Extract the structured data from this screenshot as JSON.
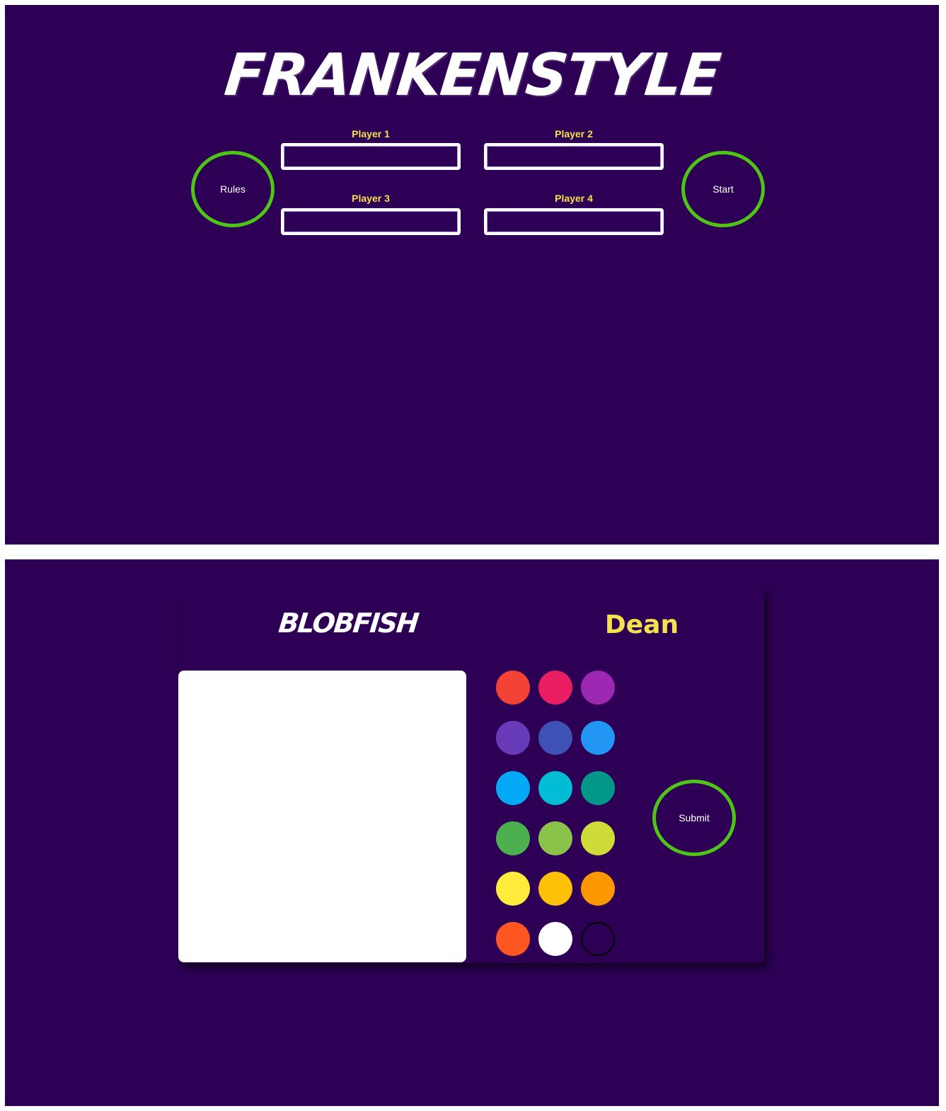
{
  "lobby": {
    "title": "FRANKENSTYLE",
    "rules_label": "Rules",
    "start_label": "Start",
    "players": [
      {
        "label": "Player 1",
        "value": ""
      },
      {
        "label": "Player 2",
        "value": ""
      },
      {
        "label": "Player 3",
        "value": ""
      },
      {
        "label": "Player 4",
        "value": ""
      }
    ]
  },
  "drawing": {
    "word": "BLOBFISH",
    "player_name": "Dean",
    "submit_label": "Submit",
    "palette": [
      "#f44336",
      "#e91e63",
      "#9c27b0",
      "#673ab7",
      "#3f51b5",
      "#2196f3",
      "#03a9f4",
      "#00bcd4",
      "#009688",
      "#4caf50",
      "#8bc34a",
      "#cddc39",
      "#ffeb3b",
      "#ffc107",
      "#ff9800",
      "#ff5722",
      "#ffffff",
      "#000000"
    ]
  },
  "colors": {
    "background": "#2d0055",
    "accent_green": "#4ec516",
    "label_yellow": "#f5e04d"
  }
}
